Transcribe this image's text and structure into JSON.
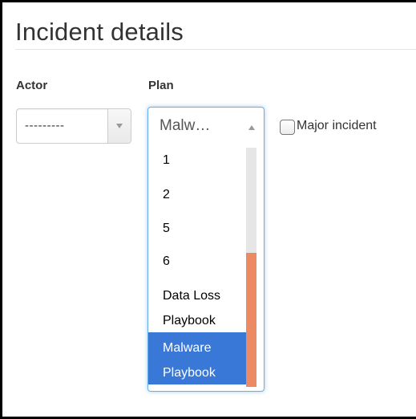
{
  "page": {
    "title": "Incident details"
  },
  "actor": {
    "label": "Actor",
    "value": "---------"
  },
  "plan": {
    "label": "Plan",
    "value": "Malw…",
    "options": [
      "1",
      "2",
      "5",
      "6",
      "Data Loss Playbook",
      "Malware Playbook"
    ],
    "selected": "Malware Playbook"
  },
  "major_incident": {
    "label": "Major incident",
    "checked": false
  },
  "colors": {
    "selected_option_bg": "#3a78d8",
    "focus_border": "#66afe9",
    "scrollbar_thumb": "#ec8b63",
    "scrollbar_track": "#e6e6e6"
  },
  "icons": {
    "actor_dropdown": "chevron-down-icon",
    "plan_dropdown": "chevron-up-icon"
  }
}
